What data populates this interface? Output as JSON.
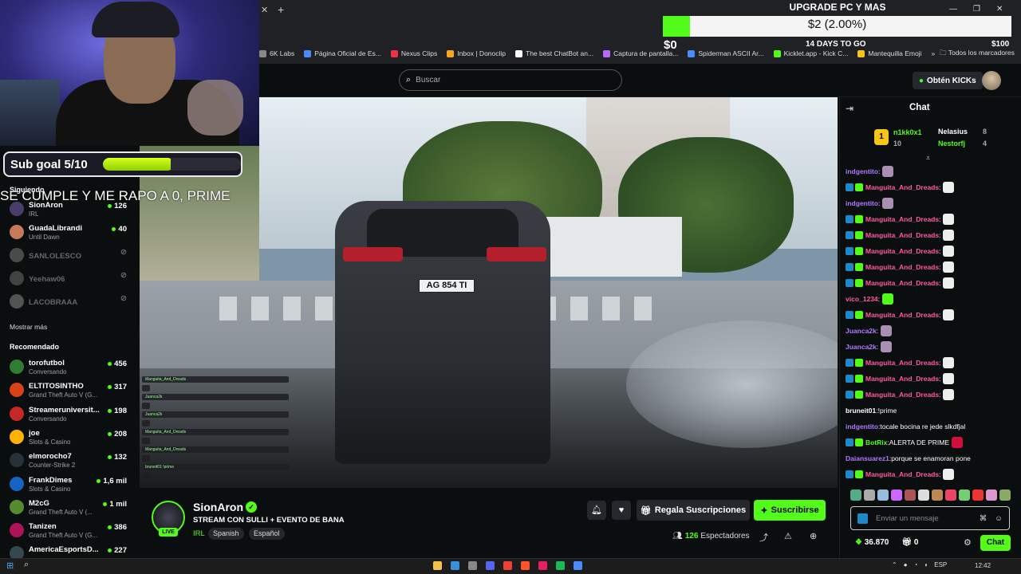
{
  "browser": {
    "bookmarks": [
      "6K Labs",
      "Página Oficial de Es...",
      "Nexus Clips",
      "Inbox | Donoclip",
      "The best ChatBot an...",
      "Captura de pantalla...",
      "Spiderman ASCII Ar...",
      "Kicklet.app - Kick C...",
      "Mantequilla Emoji"
    ],
    "bookmarks_more": "»",
    "all_bookmarks": "Todos los marcadores"
  },
  "header": {
    "search_placeholder": "Buscar",
    "kicks_button": "Obtén KICKs"
  },
  "overlay": {
    "sub_goal": "Sub goal 5/10",
    "sub_goal_progress": 0.5,
    "banner_text": "SE CUMPLE Y ME RAPO A 0, PRIME",
    "goal_title": "UPGRADE PC Y MAS",
    "goal_amount": "$2 (2.00%)",
    "goal_progress_percent": 2.0,
    "goal_min": "$0",
    "goal_days": "14 DAYS TO GO",
    "goal_max": "$100"
  },
  "sidebar": {
    "following_label": "Siguiendo",
    "following": [
      {
        "name": "SionAron",
        "category": "IRL",
        "viewers": "126",
        "online": true
      },
      {
        "name": "GuadaLibrandi",
        "category": "Until Dawn",
        "viewers": "40",
        "online": true
      },
      {
        "name": "SANLOLESCO",
        "category": "",
        "viewers": "",
        "online": false
      },
      {
        "name": "Yeehaw06",
        "category": "",
        "viewers": "",
        "online": false
      },
      {
        "name": "LACOBRAAA",
        "category": "",
        "viewers": "",
        "online": false
      }
    ],
    "show_more": "Mostrar más",
    "recommended_label": "Recomendado",
    "recommended": [
      {
        "name": "torofutbol",
        "category": "Conversando",
        "viewers": "456"
      },
      {
        "name": "ELTITOSINTHO",
        "category": "Grand Theft Auto V (G...",
        "viewers": "317"
      },
      {
        "name": "Streameruniversit...",
        "category": "Conversando",
        "viewers": "198"
      },
      {
        "name": "joe",
        "category": "Slots & Casino",
        "viewers": "208"
      },
      {
        "name": "elmorocho7",
        "category": "Counter-Strike 2",
        "viewers": "132"
      },
      {
        "name": "FrankDimes",
        "category": "Slots & Casino",
        "viewers": "1,6 mil"
      },
      {
        "name": "M2cG",
        "category": "Grand Theft Auto V (...",
        "viewers": "1 mil"
      },
      {
        "name": "Tanizen",
        "category": "Grand Theft Auto V (G...",
        "viewers": "386"
      },
      {
        "name": "AmericaEsportsD...",
        "category": "",
        "viewers": "227"
      }
    ]
  },
  "video": {
    "plate": "AG 854 TI",
    "mini_chat": [
      "Manguita_And_Dreads",
      "Juanca2k",
      "Juanca2k",
      "Manguita_And_Dreads",
      "Manguita_And_Dreads",
      "bruneit01 !prime"
    ]
  },
  "stream": {
    "streamer": "SionAron",
    "title": "STREAM CON SULLI + EVENTO DE BANA",
    "category": "IRL",
    "tags": [
      "Spanish",
      "Español"
    ],
    "live_badge": "LIVE",
    "gift_button": "Regala Suscripciones",
    "subscribe_button": "Suscribirse",
    "viewers_count": "126",
    "viewers_label": "Espectadores"
  },
  "chat": {
    "title": "Chat",
    "leaderboard": [
      {
        "rank": "1",
        "name": "n1kk0x1",
        "count": "10"
      },
      {
        "name": "Nelasius",
        "count": "8"
      },
      {
        "name": "Nestorfj",
        "count": "4"
      }
    ],
    "messages": [
      {
        "user": "indgentito",
        "text": "",
        "color": "#b07aff",
        "badges": false,
        "emote": "#a88fb3"
      },
      {
        "user": "Manguita_And_Dreads",
        "text": "",
        "color": "#ff5aa0",
        "badges": true,
        "emote": "#eee"
      },
      {
        "user": "indgentito",
        "text": "",
        "color": "#b07aff",
        "badges": false,
        "emote": "#a88fb3"
      },
      {
        "user": "Manguita_And_Dreads",
        "text": "",
        "color": "#ff5aa0",
        "badges": true,
        "emote": "#eee"
      },
      {
        "user": "Manguita_And_Dreads",
        "text": "",
        "color": "#ff5aa0",
        "badges": true,
        "emote": "#eee"
      },
      {
        "user": "Manguita_And_Dreads",
        "text": "",
        "color": "#ff5aa0",
        "badges": true,
        "emote": "#eee"
      },
      {
        "user": "Manguita_And_Dreads",
        "text": "",
        "color": "#ff5aa0",
        "badges": true,
        "emote": "#eee"
      },
      {
        "user": "Manguita_And_Dreads",
        "text": "",
        "color": "#ff5aa0",
        "badges": true,
        "emote": "#eee"
      },
      {
        "user": "vico_1234",
        "text": "",
        "color": "#ff5aa0",
        "badges": false,
        "emote": "#53fc18"
      },
      {
        "user": "Manguita_And_Dreads",
        "text": "",
        "color": "#ff5aa0",
        "badges": true,
        "emote": "#eee"
      },
      {
        "user": "Juanca2k",
        "text": "",
        "color": "#b07aff",
        "badges": false,
        "emote": "#a88fb3"
      },
      {
        "user": "Juanca2k",
        "text": "",
        "color": "#b07aff",
        "badges": false,
        "emote": "#a88fb3"
      },
      {
        "user": "Manguita_And_Dreads",
        "text": "",
        "color": "#ff5aa0",
        "badges": true,
        "emote": "#eee"
      },
      {
        "user": "Manguita_And_Dreads",
        "text": "",
        "color": "#ff5aa0",
        "badges": true,
        "emote": "#eee"
      },
      {
        "user": "Manguita_And_Dreads",
        "text": "",
        "color": "#ff5aa0",
        "badges": true,
        "emote": "#eee"
      },
      {
        "user": "bruneit01",
        "text": "!prime",
        "color": "#ffffff",
        "badges": false,
        "emote": ""
      },
      {
        "user": "indgentito",
        "text": "tocale bocina re jede slkdfjal",
        "color": "#b07aff",
        "badges": false,
        "emote": ""
      },
      {
        "user": "BotRix",
        "text": "ALERTA DE PRIME",
        "color": "#53fc18",
        "badges": true,
        "emote": "#d0103a"
      },
      {
        "user": "Daiansuarez1",
        "text": "porque se enamoran pone",
        "color": "#b07aff",
        "badges": false,
        "emote": ""
      },
      {
        "user": "Manguita_And_Dreads",
        "text": "",
        "color": "#ff5aa0",
        "badges": true,
        "emote": "#eee"
      }
    ],
    "input_placeholder": "Enviar un mensaje",
    "points": "36.870",
    "gift_count": "0",
    "chat_button": "Chat"
  },
  "taskbar": {
    "lang": "ESP",
    "time": "12:42"
  },
  "colors": {
    "accent": "#53fc18",
    "bg": "#0b0e0f",
    "panel": "#24272c"
  }
}
